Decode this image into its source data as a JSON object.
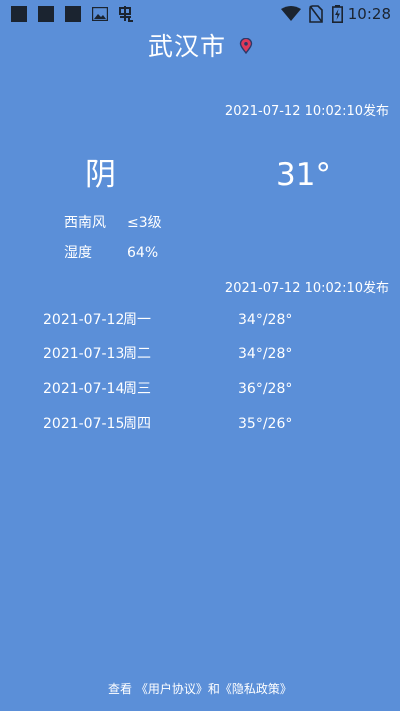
{
  "status_bar": {
    "time": "10:28",
    "icons": [
      "notification-square-icon",
      "notification-square-icon",
      "notification-square-icon",
      "image-icon",
      "app-icon",
      "wifi-icon",
      "no-sim-icon",
      "battery-charging-icon"
    ]
  },
  "city": {
    "name": "武汉市",
    "icon": "location-pin-icon"
  },
  "current": {
    "published": "2021-07-12 10:02:10发布",
    "condition": "阴",
    "temperature": "31°",
    "wind_label": "西南风",
    "wind_value": "≤3级",
    "humidity_label": "湿度",
    "humidity_value": "64%"
  },
  "forecast": {
    "published": "2021-07-12 10:02:10发布",
    "days": [
      {
        "date": "2021-07-12",
        "weekday": "周一",
        "temp": "34°/28°"
      },
      {
        "date": "2021-07-13",
        "weekday": "周二",
        "temp": "34°/28°"
      },
      {
        "date": "2021-07-14",
        "weekday": "周三",
        "temp": "36°/28°"
      },
      {
        "date": "2021-07-15",
        "weekday": "周四",
        "temp": "35°/26°"
      }
    ]
  },
  "footer": {
    "prefix": "查看",
    "user_agreement": "《用户协议》",
    "and": "和",
    "privacy_policy": "《隐私政策》"
  },
  "colors": {
    "background": "#5b8fd8",
    "text": "#ffffff",
    "status_icons": "#1b2430",
    "pin_fill": "#e0395a",
    "pin_stroke": "#2a3a6a"
  }
}
